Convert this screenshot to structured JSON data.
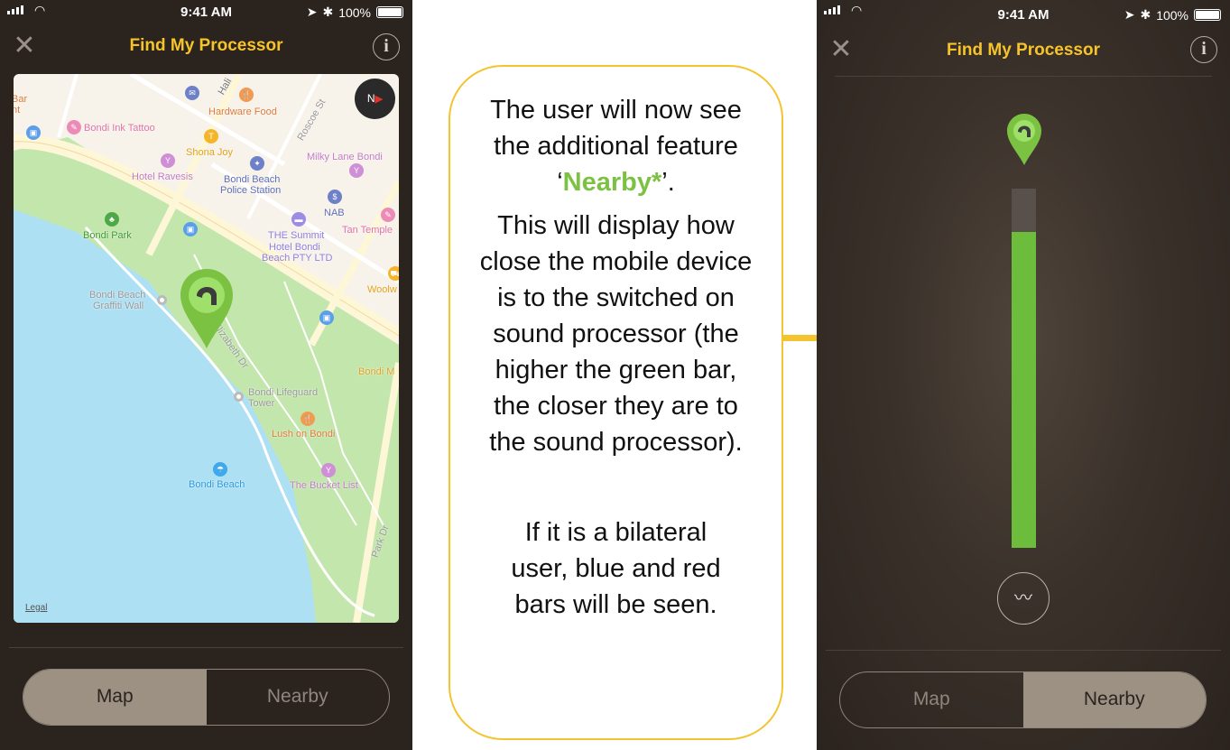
{
  "status_bar": {
    "time": "9:41 AM",
    "battery": "100%"
  },
  "app": {
    "title": "Find My Processor",
    "close_icon": "close-icon",
    "info_icon": "info-icon",
    "accent": "#f6c42a"
  },
  "left_phone": {
    "segments": [
      {
        "label": "Map",
        "selected": true
      },
      {
        "label": "Nearby",
        "selected": false
      }
    ],
    "map": {
      "labels": {
        "bar": "Bar",
        "nt": "nt",
        "hali": "Hali",
        "hardware_food": "Hardware Food",
        "bondi_ink_tattoo": "Bondi Ink Tattoo",
        "roscoe_st": "Roscoe St",
        "shona_joy": "Shona Joy",
        "milky_lane": "Milky Lane Bondi",
        "hotel_ravesis": "Hotel Ravesis",
        "police_1": "Bondi Beach",
        "police_2": "Police Station",
        "nab": "NAB",
        "tan_temple": "Tan Temple",
        "bondi_park": "Bondi Park",
        "summit_1": "THE Summit",
        "summit_2": "Hotel Bondi",
        "summit_3": "Beach PTY LTD",
        "woolw": "Woolw",
        "graffiti_1": "Bondi Beach",
        "graffiti_2": "Graffiti Wall",
        "qe_dr": "Queen Elizabeth Dr",
        "bondi_m": "Bondi M",
        "lifeguard_1": "Bondi Lifeguard",
        "lifeguard_2": "Tower",
        "lush": "Lush on Bondi",
        "bondi_beach": "Bondi Beach",
        "bucket_list": "The Bucket List",
        "park_dr": "Park Dr",
        "compass": "N"
      },
      "legal": "Legal",
      "colors": {
        "land": "#f7f2ea",
        "park": "#c3e6ad",
        "water": "#aee0f3",
        "road": "#fdf7d8",
        "pin": "#7cc242"
      }
    }
  },
  "callout": {
    "p1_pre": "The user will now see the additional feature ‘",
    "p1_highlight": "Nearby*",
    "p1_post": "’.",
    "p2": "This will display how close the mobile device is to the switched on sound processor (the higher the green bar, the closer they are to the sound processor).",
    "p3": "If it is a bilateral user, blue and red bars will be seen.",
    "border_color": "#f4c430",
    "highlight_color": "#7dc142"
  },
  "right_phone": {
    "proximity_level": 0.88,
    "bar_color": "#6cbd3c",
    "pulse_icon": "waveform-icon",
    "segments": [
      {
        "label": "Map",
        "selected": false
      },
      {
        "label": "Nearby",
        "selected": true
      }
    ]
  }
}
